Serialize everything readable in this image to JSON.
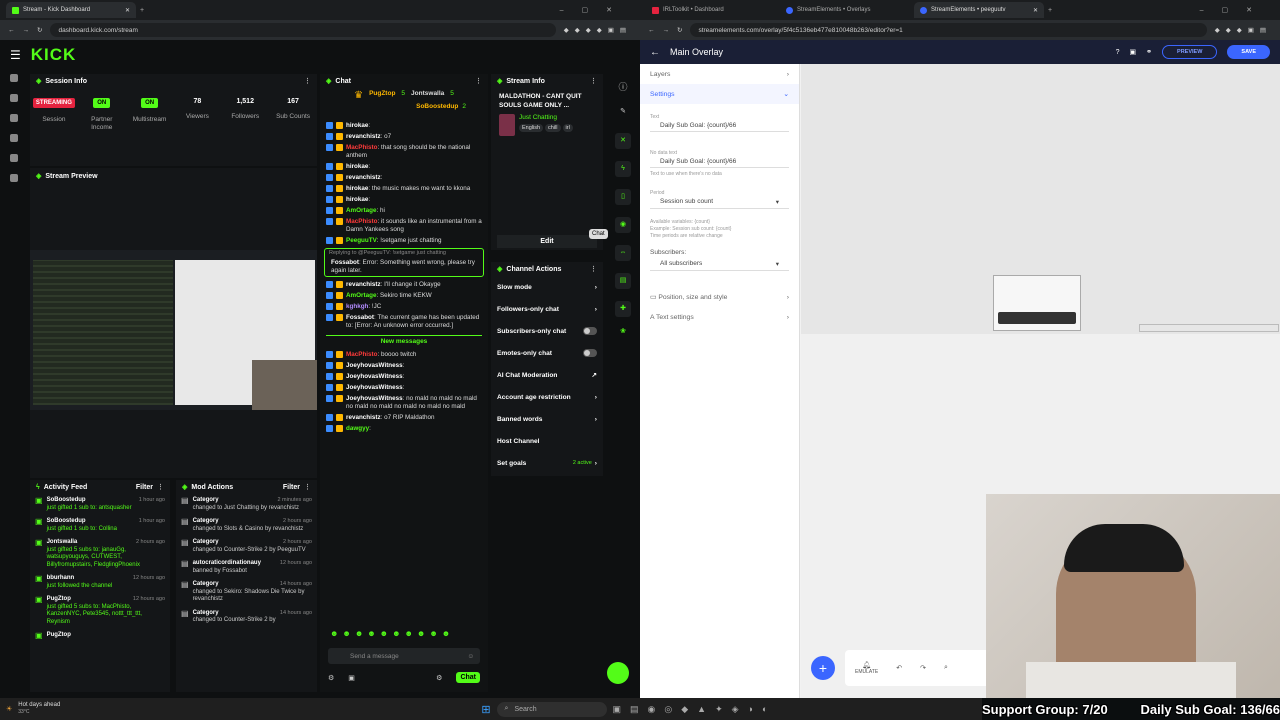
{
  "left_browser": {
    "tabs": [
      {
        "title": "Stream - Kick Dashboard"
      }
    ],
    "url": "dashboard.kick.com/stream",
    "logo": "KICK"
  },
  "session_info": {
    "title": "Session Info",
    "stats": [
      {
        "value": "STREAMING",
        "label": "Session",
        "kind": "badge-red"
      },
      {
        "value": "ON",
        "label": "Partner Income",
        "kind": "badge-green"
      },
      {
        "value": "ON",
        "label": "Multistream",
        "kind": "badge-green"
      },
      {
        "value": "78",
        "label": "Viewers"
      },
      {
        "value": "1,512",
        "label": "Followers"
      },
      {
        "value": "167",
        "label": "Sub Counts"
      }
    ]
  },
  "stream_preview": {
    "title": "Stream Preview"
  },
  "chat": {
    "title": "Chat",
    "gifters": [
      {
        "name": "PugZtop",
        "count": "5"
      },
      {
        "name": "Jontswalla",
        "count": "5"
      },
      {
        "name": "SoBoostedup",
        "count": "2"
      }
    ],
    "messages": [
      {
        "user": "hirokae",
        "text": "",
        "color": "#fff"
      },
      {
        "user": "revanchistz",
        "text": "o7",
        "color": "#fff"
      },
      {
        "user": "MacPhisto",
        "text": "that song should be the national anthem",
        "color": "#ff3b3b"
      },
      {
        "user": "hirokae",
        "text": "",
        "color": "#fff"
      },
      {
        "user": "revanchistz",
        "text": "",
        "color": "#fff"
      },
      {
        "user": "hirokae",
        "text": "the music makes me want to kkona",
        "color": "#fff"
      },
      {
        "user": "hirokae",
        "text": "",
        "color": "#fff"
      },
      {
        "user": "AmOrtage",
        "text": "hi",
        "color": "#53fc18"
      },
      {
        "user": "MacPhisto",
        "text": "it sounds like an instrumental from a Damn Yankees song",
        "color": "#ff3b3b"
      },
      {
        "user": "PeeguuTV",
        "text": "!setgame just chatting",
        "color": "#53fc18"
      }
    ],
    "reply_label": "Replying to @PeeguuTV: !setgame just chatting",
    "reply_message": {
      "user": "Fossabot",
      "text": "Error: Something went wrong, please try again later.",
      "color": "#fff"
    },
    "messages2": [
      {
        "user": "revanchistz",
        "text": "I'll change it Okayge",
        "color": "#fff"
      },
      {
        "user": "AmOrtage",
        "text": "Sekiro time KEKW",
        "color": "#53fc18"
      },
      {
        "user": "kghkgh",
        "text": "!JC",
        "color": "#b38cff"
      },
      {
        "user": "Fossabot",
        "text": "The current game has been updated to: [Error: An unknown error occurred.]",
        "color": "#fff"
      }
    ],
    "new_messages_label": "New messages",
    "messages3": [
      {
        "user": "MacPhisto",
        "text": "boooo twitch",
        "color": "#ff3b3b"
      },
      {
        "user": "JoeyhovasWitness",
        "text": "",
        "color": "#fff"
      },
      {
        "user": "JoeyhovasWitness",
        "text": "",
        "color": "#fff"
      },
      {
        "user": "JoeyhovasWitness",
        "text": "",
        "color": "#fff"
      },
      {
        "user": "JoeyhovasWitness",
        "text": "no mald no mald no mald no mald no mald no mald no mald no mald",
        "color": "#fff"
      },
      {
        "user": "revanchistz",
        "text": "o7 RIP Maldathon",
        "color": "#fff"
      },
      {
        "user": "dawgyy",
        "text": "",
        "color": "#53fc18"
      }
    ],
    "input_placeholder": "Send a message",
    "send_label": "Chat"
  },
  "stream_info": {
    "title": "Stream Info",
    "stream_title": "MALDATHON - CANT QUIT SOULS GAME ONLY ...",
    "category": "Just Chatting",
    "tags": [
      "English",
      "chill",
      "irl"
    ],
    "edit_label": "Edit",
    "tooltip": "Chat"
  },
  "channel_actions": {
    "title": "Channel Actions",
    "items": [
      {
        "label": "Slow mode",
        "control": "chevron"
      },
      {
        "label": "Followers-only chat",
        "control": "chevron"
      },
      {
        "label": "Subscribers-only chat",
        "control": "toggle"
      },
      {
        "label": "Emotes-only chat",
        "control": "toggle"
      },
      {
        "label": "AI Chat Moderation",
        "control": "external"
      },
      {
        "label": "Account age restriction",
        "control": "chevron"
      },
      {
        "label": "Banned words",
        "control": "chevron"
      },
      {
        "label": "Host Channel",
        "control": "none"
      },
      {
        "label": "Set goals",
        "control": "chevron",
        "badge": "2 active"
      }
    ]
  },
  "activity_feed": {
    "title": "Activity Feed",
    "filter_label": "Filter",
    "items": [
      {
        "user": "SoBoostedup",
        "time": "1 hour ago",
        "text": "just gifted 1 sub to: antsquasher"
      },
      {
        "user": "SoBoostedup",
        "time": "1 hour ago",
        "text": "just gifted 1 sub to: Collina"
      },
      {
        "user": "Jontswalla",
        "time": "2 hours ago",
        "text": "just gifted 5 subs to: janauGg, watsupyouguys, CUTWEST, Billyfromupstairs, FledglingPhoenix"
      },
      {
        "user": "bburhann",
        "time": "12 hours ago",
        "text": "just followed the channel"
      },
      {
        "user": "PugZtop",
        "time": "12 hours ago",
        "text": "just gifted 5 subs to: MacPhisto, KanzenNYC, Pete3545, nottt_ttt_ttt, Reynism"
      },
      {
        "user": "PugZtop",
        "time": "",
        "text": ""
      }
    ]
  },
  "mod_actions": {
    "title": "Mod Actions",
    "filter_label": "Filter",
    "items": [
      {
        "title": "Category",
        "time": "2 minutes ago",
        "text": "changed to Just Chatting by revanchistz"
      },
      {
        "title": "Category",
        "time": "2 hours ago",
        "text": "changed to Slots & Casino by revanchistz"
      },
      {
        "title": "Category",
        "time": "2 hours ago",
        "text": "changed to Counter-Strike 2 by PeeguuTV"
      },
      {
        "title": "autocraticordinationauy",
        "time": "12 hours ago",
        "text": "banned by Fossabot"
      },
      {
        "title": "Category",
        "time": "14 hours ago",
        "text": "changed to Sekiro: Shadows Die Twice by revanchistz"
      },
      {
        "title": "Category",
        "time": "14 hours ago",
        "text": "changed to Counter-Strike 2 by"
      }
    ]
  },
  "right_browser": {
    "tabs": [
      {
        "title": "IRLToolkit • Dashboard"
      },
      {
        "title": "StreamElements • Overlays"
      },
      {
        "title": "StreamElements • peeguutv"
      }
    ],
    "url": "streamelements.com/overlay/5f4c5136eb477e810048b263/editor?er=1"
  },
  "overlay_editor": {
    "title": "Main Overlay",
    "preview_label": "PREVIEW",
    "save_label": "SAVE",
    "layers_label": "Layers",
    "settings_label": "Settings",
    "text_label": "Text",
    "text_value": "Daily Sub Goal: {count}/66",
    "no_data_label": "No data text",
    "no_data_value": "Daily Sub Goal: {count}/66",
    "no_data_help": "Text to use when there's no data",
    "period_label": "Period",
    "period_value": "Session sub count",
    "vars_line1": "Available variables: {count}",
    "vars_line2": "Example: Session sub count: {count}",
    "vars_line3": "Time periods are relative change",
    "subscribers_label": "Subscribers:",
    "subscribers_value": "All subscribers",
    "position_label": "Position, size and style",
    "text_settings_label": "Text settings",
    "emulate_label": "EMULATE"
  },
  "stream_overlay": {
    "support_group": "Support Group: 7/20",
    "daily_goal": "Daily Sub Goal: 136/66"
  },
  "taskbar": {
    "weather": "Hot days ahead",
    "temp": "33°C",
    "search_placeholder": "Search"
  },
  "colors": {
    "kick_green": "#53fc18",
    "streaming_red": "#e5233f",
    "se_blue": "#3b66ff"
  }
}
